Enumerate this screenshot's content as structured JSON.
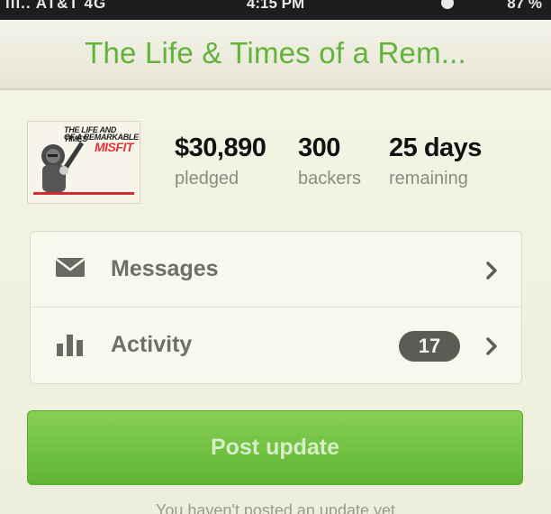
{
  "status_bar": {
    "carrier": "ııı.. AT&T  4G",
    "time": "4:15 PM",
    "battery": "87 %"
  },
  "nav": {
    "title": "The Life & Times of a Rem..."
  },
  "project": {
    "thumbnail": {
      "line1": "THE LIFE AND TIMES",
      "line2": "OF A REMARKABLE",
      "word": "MISFIT"
    },
    "stats": [
      {
        "value": "$30,890",
        "label": "pledged"
      },
      {
        "value": "300",
        "label": "backers"
      },
      {
        "value": "25 days",
        "label": "remaining"
      }
    ]
  },
  "menu": {
    "messages_label": "Messages",
    "activity_label": "Activity",
    "activity_badge": "17"
  },
  "actions": {
    "post_update_label": "Post update"
  },
  "footer": {
    "note": "You haven't posted an update yet"
  },
  "colors": {
    "accent_green": "#63b33b",
    "button_green": "#6fc040",
    "badge_gray": "#5c5c56"
  },
  "icons": {
    "messages": "envelope-icon",
    "activity": "bar-chart-icon",
    "chevron": "chevron-right-icon"
  }
}
